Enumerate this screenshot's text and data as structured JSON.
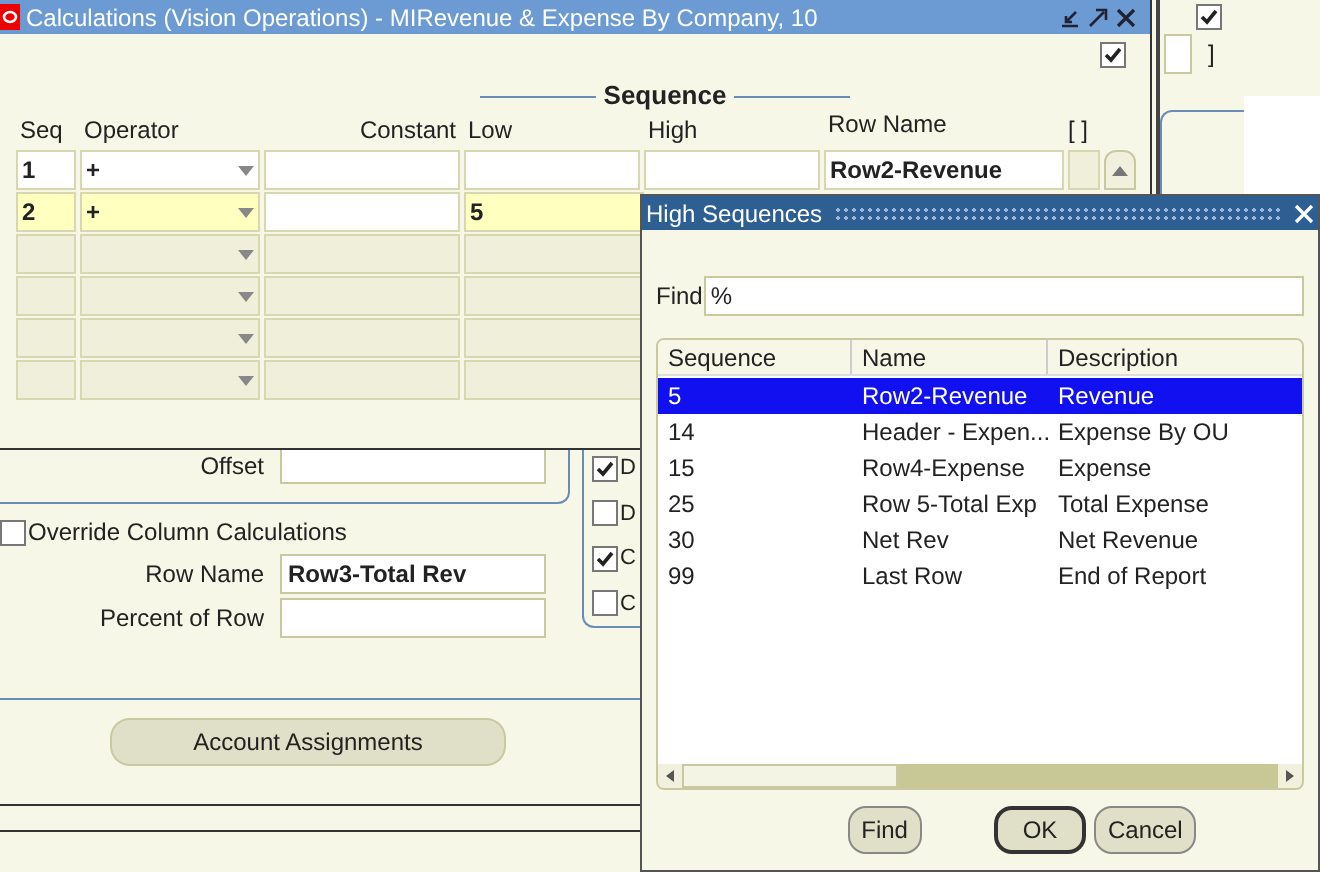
{
  "background_window": {
    "checkbox_checked": true,
    "bracket_label": "]"
  },
  "form": {
    "offset_label": "Offset",
    "override": {
      "label": "Override Column Calculations",
      "checked": false
    },
    "row_name": {
      "label": "Row Name",
      "value": "Row3-Total Rev"
    },
    "percent_of_row": {
      "label": "Percent of Row"
    },
    "account_button": "Account Assignments",
    "options": [
      {
        "label": "D",
        "checked": true
      },
      {
        "label": "D",
        "checked": false
      },
      {
        "label": "C",
        "checked": true
      },
      {
        "label": "C",
        "checked": false
      }
    ]
  },
  "calculations_window": {
    "title": "Calculations (Vision Operations) - MIRevenue & Expense By Company, 10",
    "header_checkbox_checked": true,
    "section_title": "Sequence",
    "columns": [
      "Seq",
      "Operator",
      "Constant",
      "Low",
      "High",
      "Row Name",
      "[ ]"
    ],
    "rows": [
      {
        "seq": "1",
        "operator": "+",
        "row_name": "Row2-Revenue",
        "selected": false
      },
      {
        "seq": "2",
        "operator": "+",
        "low": "5",
        "selected": true
      },
      {
        "selected": false
      },
      {
        "selected": false
      },
      {
        "selected": false
      },
      {
        "selected": false
      }
    ]
  },
  "dialog": {
    "title": "High Sequences",
    "find_label": "Find",
    "find_value": "%",
    "columns": [
      "Sequence",
      "Name",
      "Description"
    ],
    "rows": [
      {
        "sequence": "5",
        "name": "Row2-Revenue",
        "description": "Revenue",
        "selected": true
      },
      {
        "sequence": "14",
        "name": "Header - Expen...",
        "description": "Expense By OU",
        "selected": false
      },
      {
        "sequence": "15",
        "name": "Row4-Expense",
        "description": "Expense",
        "selected": false
      },
      {
        "sequence": "25",
        "name": "Row 5-Total Exp",
        "description": "Total Expense",
        "selected": false
      },
      {
        "sequence": "30",
        "name": "Net Rev",
        "description": "Net Revenue",
        "selected": false
      },
      {
        "sequence": "99",
        "name": "Last Row",
        "description": "End of Report",
        "selected": false
      }
    ],
    "buttons": [
      {
        "label": "Find",
        "default": false
      },
      {
        "label": "OK",
        "default": true
      },
      {
        "label": "Cancel",
        "default": false
      }
    ]
  }
}
